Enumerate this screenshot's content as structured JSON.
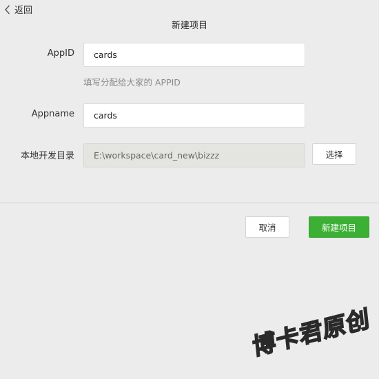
{
  "nav": {
    "back_label": "返回"
  },
  "page": {
    "title": "新建项目"
  },
  "form": {
    "appid": {
      "label": "AppID",
      "value": "cards",
      "hint": "填写分配给大家的 APPID"
    },
    "appname": {
      "label": "Appname",
      "value": "cards"
    },
    "local_dir": {
      "label": "本地开发目录",
      "value": "E:\\workspace\\card_new\\bizzz",
      "choose_label": "选择"
    }
  },
  "actions": {
    "cancel_label": "取消",
    "create_label": "新建项目"
  },
  "watermark": {
    "text": "博卡君原创"
  },
  "colors": {
    "background": "#ececec",
    "primary": "#3cb035",
    "hint": "#8a8a8a",
    "readonly_bg": "#e4e4e0"
  },
  "icons": {
    "back": "chevron-left-icon"
  }
}
